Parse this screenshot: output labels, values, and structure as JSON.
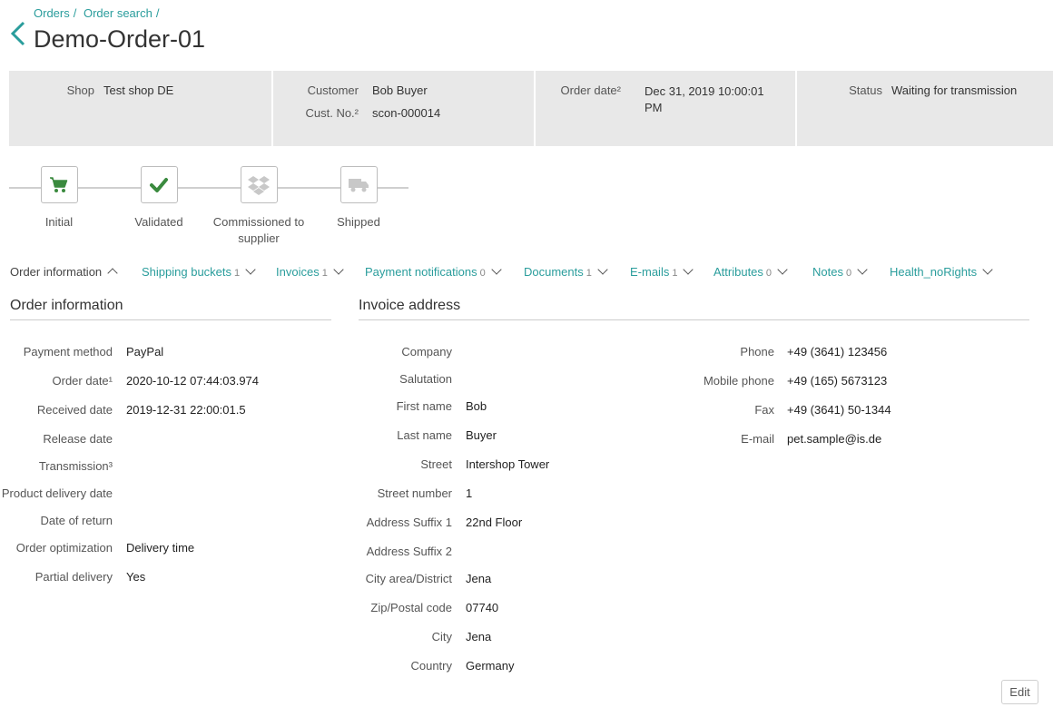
{
  "breadcrumb": [
    "Orders",
    "Order search"
  ],
  "breadcrumb_sep": "/",
  "title": "Demo-Order-01",
  "info": {
    "shop_label": "Shop",
    "shop_value": "Test shop DE",
    "customer_label": "Customer",
    "customer_value": "Bob Buyer",
    "custno_label": "Cust. No.²",
    "custno_value": "scon-000014",
    "orderdate_label": "Order date²",
    "orderdate_value_line1": "Dec 31, 2019 10:00:01",
    "orderdate_value_line2": "PM",
    "status_label": "Status",
    "status_value": "Waiting for transmission"
  },
  "steps": [
    {
      "label": "Initial",
      "icon": "cart-icon",
      "active": true
    },
    {
      "label": "Validated",
      "icon": "check-icon",
      "active": true
    },
    {
      "label_line1": "Commissioned to",
      "label_line2": "supplier",
      "icon": "dropbox-icon",
      "active": false
    },
    {
      "label": "Shipped",
      "icon": "truck-icon",
      "active": false
    }
  ],
  "tabs": [
    {
      "label": "Order information",
      "count": ""
    },
    {
      "label": "Shipping buckets",
      "count": "1"
    },
    {
      "label": "Invoices",
      "count": "1"
    },
    {
      "label": "Payment notifications",
      "count": "0"
    },
    {
      "label": "Documents",
      "count": "1"
    },
    {
      "label": "E-mails",
      "count": "1"
    },
    {
      "label": "Attributes",
      "count": "0"
    },
    {
      "label": "Notes",
      "count": "0"
    },
    {
      "label": "Health_noRights",
      "count": ""
    }
  ],
  "order_info": {
    "title": "Order information",
    "rows": [
      {
        "label": "Payment method",
        "value": "PayPal"
      },
      {
        "label": "Order date¹",
        "value": "2020-10-12 07:44:03.974"
      },
      {
        "label": "Received date",
        "value": "2019-12-31 22:00:01.5"
      },
      {
        "label": "Release date",
        "value": ""
      },
      {
        "label": "Transmission³",
        "value": ""
      },
      {
        "label": "Product delivery date",
        "value": ""
      },
      {
        "label": "Date of return",
        "value": ""
      },
      {
        "label": "Order optimization",
        "value": "Delivery time"
      },
      {
        "label": "Partial delivery",
        "value": "Yes"
      }
    ]
  },
  "invoice_address": {
    "title": "Invoice address",
    "rows": [
      {
        "label": "Company",
        "value": ""
      },
      {
        "label": "Salutation",
        "value": ""
      },
      {
        "label": "First name",
        "value": "Bob"
      },
      {
        "label": "Last name",
        "value": "Buyer"
      },
      {
        "label": "Street",
        "value": "Intershop Tower"
      },
      {
        "label": "Street number",
        "value": "1"
      },
      {
        "label": "Address Suffix 1",
        "value": "22nd Floor"
      },
      {
        "label": "Address Suffix 2",
        "value": ""
      },
      {
        "label": "City area/District",
        "value": "Jena"
      },
      {
        "label": "Zip/Postal code",
        "value": "07740"
      },
      {
        "label": "City",
        "value": "Jena"
      },
      {
        "label": "Country",
        "value": "Germany"
      }
    ],
    "contact_rows": [
      {
        "label": "Phone",
        "value": "+49 (3641) 123456"
      },
      {
        "label": "Mobile phone",
        "value": "+49 (165) 5673123"
      },
      {
        "label": "Fax",
        "value": "+49 (3641) 50-1344"
      },
      {
        "label": "E-mail",
        "value": "pet.sample@is.de"
      }
    ]
  },
  "edit_label": "Edit",
  "colors": {
    "accent": "#2a9d9c",
    "done_icon": "#3a8a3e",
    "pending_icon": "#c8c8c8",
    "info_bg": "#e8e8e8"
  }
}
